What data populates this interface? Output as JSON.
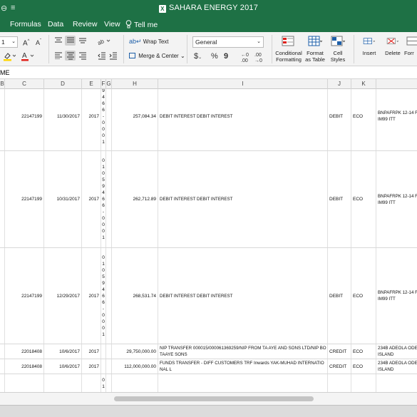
{
  "window": {
    "title": "SAHARA ENERGY 2017",
    "quick_access": [
      "⊖",
      "≡"
    ]
  },
  "tabs": [
    "Formulas",
    "Data",
    "Review",
    "View"
  ],
  "tell_me": "Tell me",
  "ribbon": {
    "font_size": "1",
    "wrap_text": "Wrap Text",
    "merge_center": "Merge & Center",
    "number_format": "General",
    "conditional_formatting": [
      "Conditional",
      "Formatting"
    ],
    "format_as_table": [
      "Format",
      "as Table"
    ],
    "cell_styles": [
      "Cell",
      "Styles"
    ],
    "insert": "Insert",
    "delete": "Delete",
    "format": "Forr",
    "currency": "$",
    "percent": "%",
    "comma": "9",
    "dec_inc": "←0 .00",
    "dec_dec": ".00 →0"
  },
  "formula_bar": {
    "name_box": "ME"
  },
  "columns": [
    "B",
    "C",
    "D",
    "E",
    "F",
    "G",
    "H",
    "I",
    "J",
    "K",
    ""
  ],
  "rows": [
    {
      "account": "22147199",
      "date": "11/30/2017",
      "year": "2017",
      "ref_chars": [
        "9",
        "4",
        "6",
        "6",
        "-",
        "0",
        "0",
        "0",
        "1"
      ],
      "amount": "257,084.34",
      "description": "DEBIT INTEREST DEBIT INTEREST",
      "type": "DEBIT",
      "bank": "ECO",
      "beneficiary": "BNPAFRPK 12-14 F IM99 ITT"
    },
    {
      "account": "22147199",
      "date": "10/31/2017",
      "year": "2017",
      "ref_chars": [
        "0",
        "1",
        "0",
        "5",
        "9",
        "4",
        "6",
        "6",
        "-",
        "0",
        "0",
        "0",
        "1"
      ],
      "amount": "262,712.89",
      "description": "DEBIT INTEREST DEBIT INTEREST",
      "type": "DEBIT",
      "bank": "ECO",
      "beneficiary": "BNPAFRPK 12-14 F IM99 ITT"
    },
    {
      "account": "22147199",
      "date": "12/29/2017",
      "year": "2017",
      "ref_chars": [
        "0",
        "1",
        "0",
        "5",
        "9",
        "4",
        "6",
        "6",
        "-",
        "0",
        "0",
        "0",
        "1"
      ],
      "amount": "268,531.74",
      "description": "DEBIT INTEREST DEBIT INTEREST",
      "type": "DEBIT",
      "bank": "ECO",
      "beneficiary": "BNPAFRPK 12-14 F IM99 ITT"
    },
    {
      "account": "22018408",
      "date": "10/6/2017",
      "year": "2017",
      "ref_chars": [],
      "amount": "29,750,000.00",
      "description": "NIP TRANSFER 000015/000061369259/NIP FROM TA AYE AND SONS LTD/NIP BO TAAYE SONS",
      "type": "CREDIT",
      "bank": "ECO",
      "beneficiary": "234B ADEOLA ODE ISLAND"
    },
    {
      "account": "22018408",
      "date": "10/6/2017",
      "year": "2017",
      "ref_chars": [],
      "amount": "112,000,000.00",
      "description": "FUNDS TRANSFER - DIFF CUSTOMERS TRF Inwards YAK-MUHAD INTERNATIONAL L",
      "type": "CREDIT",
      "bank": "ECO",
      "beneficiary": "234B ADEOLA ODE ISLAND"
    },
    {
      "account": "",
      "date": "",
      "year": "",
      "ref_chars": [
        "0",
        "1"
      ],
      "amount": "",
      "description": "",
      "type": "",
      "bank": "",
      "beneficiary": ""
    }
  ]
}
